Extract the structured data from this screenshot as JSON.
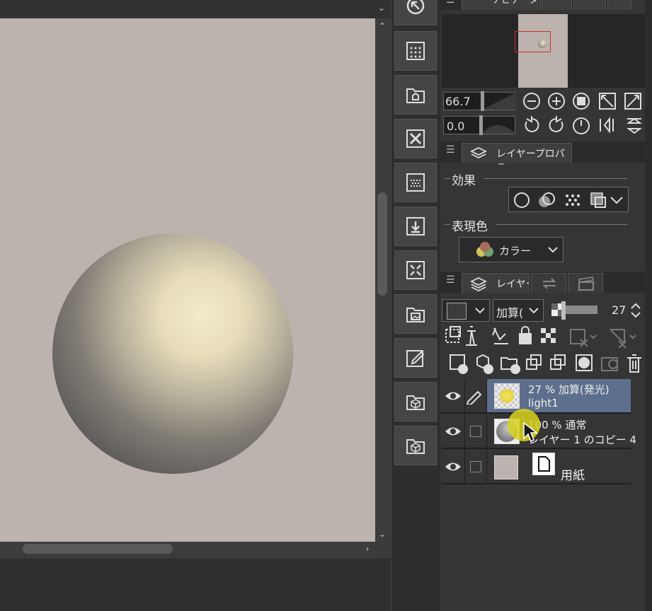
{
  "canvas": {
    "paper_color": "#bcb2ae",
    "scroll_arrows": {
      "up": "⌃",
      "down": "⌄",
      "right": "›",
      "top": "⌄"
    }
  },
  "tool_strip": {
    "buttons": [
      "navigate-icon",
      "halftone-grid-icon",
      "house-folder-icon",
      "close-x-icon",
      "dot-pattern-icon",
      "import-down-icon",
      "expand-arrows-icon",
      "image-frame-icon",
      "edit-pencil-icon",
      "3d-cube-icon",
      "3d-cube-icon"
    ]
  },
  "navigator": {
    "tab_label": "ナビゲーター",
    "zoom_value": "66.7",
    "rotation_value": "0.0"
  },
  "layer_property": {
    "tab_label": "レイヤープロパティ",
    "effect_label": "効果",
    "expression_color_label": "表現色",
    "color_mode": "カラー"
  },
  "layers_panel": {
    "tab_label": "レイヤー",
    "blend_mode": "加算(",
    "opacity_value": "27",
    "layers": [
      {
        "mode": "27 % 加算(発光)",
        "name": "light1",
        "selected": true
      },
      {
        "mode": "100 % 通常",
        "name": "レイヤー 1 のコピー 4",
        "selected": false
      },
      {
        "mode": "",
        "name": "用紙",
        "selected": false
      }
    ]
  },
  "colors": {
    "selected_row": "#5d6f8c",
    "highlight_cursor": "#d9d21e",
    "navigator_frame": "#d23030"
  }
}
